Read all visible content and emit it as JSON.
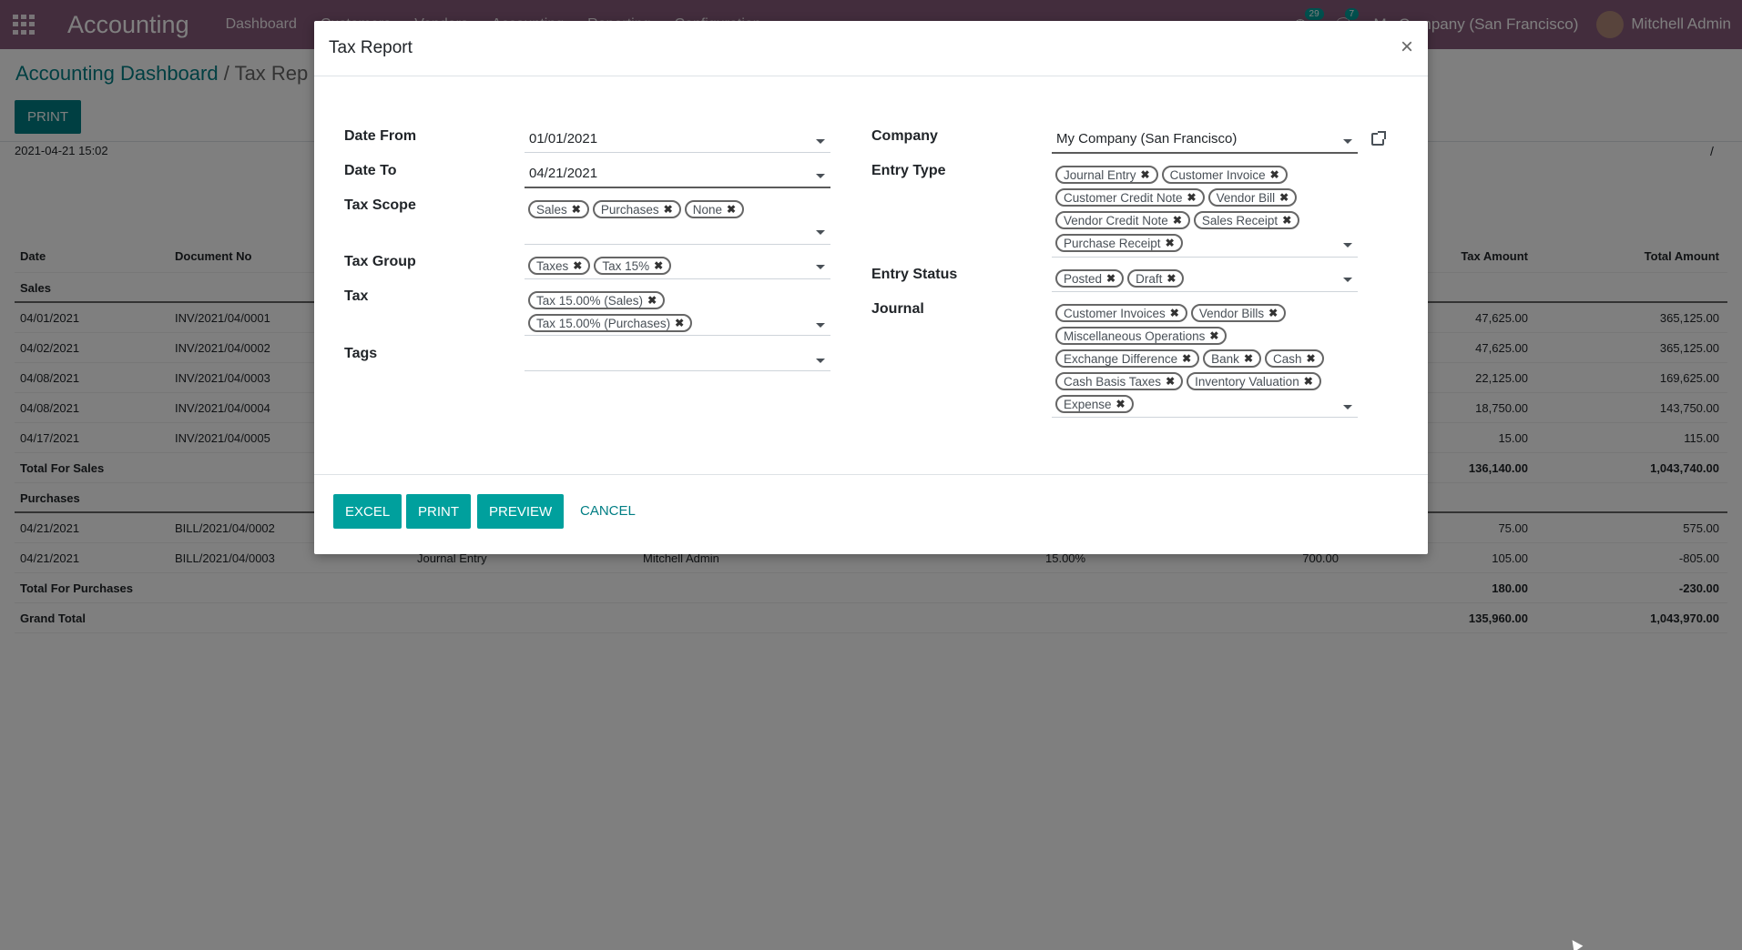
{
  "navbar": {
    "app_title": "Accounting",
    "menu": [
      "Dashboard",
      "Customers",
      "Vendors",
      "Accounting",
      "Reporting",
      "Configuration"
    ],
    "activity_count": "29",
    "messages_count": "7",
    "company": "My Company (San Francisco)",
    "user": "Mitchell Admin",
    "color": "#875A7B"
  },
  "breadcrumb": {
    "parent": "Accounting Dashboard",
    "separator": "/",
    "current": "Tax Rep"
  },
  "page": {
    "print_label": "PRINT",
    "generated_at": "2021-04-21 15:02",
    "slash": "/"
  },
  "report": {
    "headers": {
      "date": "Date",
      "document": "Document No",
      "tax_amount": "Tax Amount",
      "total_amount": "Total Amount"
    },
    "sales": {
      "title": "Sales",
      "rows": [
        {
          "date": "04/01/2021",
          "doc": "INV/2021/04/0001",
          "tax": "47,625.00",
          "total": "365,125.00"
        },
        {
          "date": "04/02/2021",
          "doc": "INV/2021/04/0002",
          "tax": "47,625.00",
          "total": "365,125.00"
        },
        {
          "date": "04/08/2021",
          "doc": "INV/2021/04/0003",
          "tax": "22,125.00",
          "total": "169,625.00"
        },
        {
          "date": "04/08/2021",
          "doc": "INV/2021/04/0004",
          "tax": "18,750.00",
          "total": "143,750.00"
        },
        {
          "date": "04/17/2021",
          "doc": "INV/2021/04/0005",
          "tax": "15.00",
          "total": "115.00"
        }
      ],
      "total_label": "Total For Sales",
      "total_tax": "136,140.00",
      "total_amount": "1,043,740.00"
    },
    "purchases": {
      "title": "Purchases",
      "rows": [
        {
          "date": "04/21/2021",
          "doc": "BILL/2021/04/0002",
          "type": "",
          "user": "",
          "rate": "",
          "base": "",
          "tax": "75.00",
          "total": "575.00"
        },
        {
          "date": "04/21/2021",
          "doc": "BILL/2021/04/0003",
          "type": "Journal Entry",
          "user": "Mitchell Admin",
          "rate": "15.00%",
          "base": "700.00",
          "tax": "105.00",
          "total": "-805.00"
        }
      ],
      "total_label": "Total For Purchases",
      "total_tax": "180.00",
      "total_amount": "-230.00"
    },
    "grand_total": {
      "label": "Grand Total",
      "tax": "135,960.00",
      "total": "1,043,970.00"
    }
  },
  "modal": {
    "title": "Tax Report",
    "close": "×",
    "fields": {
      "date_from": {
        "label": "Date From",
        "value": "01/01/2021"
      },
      "date_to": {
        "label": "Date To",
        "value": "04/21/2021"
      },
      "tax_scope": {
        "label": "Tax Scope",
        "tags": [
          "Sales",
          "Purchases",
          "None"
        ]
      },
      "tax_group": {
        "label": "Tax Group",
        "tags": [
          "Taxes",
          "Tax 15%"
        ]
      },
      "tax": {
        "label": "Tax",
        "tags": [
          "Tax 15.00% (Sales)",
          "Tax 15.00% (Purchases)"
        ]
      },
      "tags": {
        "label": "Tags",
        "tags": []
      },
      "company": {
        "label": "Company",
        "value": "My Company (San Francisco)"
      },
      "entry_type": {
        "label": "Entry Type",
        "tags": [
          "Journal Entry",
          "Customer Invoice",
          "Customer Credit Note",
          "Vendor Bill",
          "Vendor Credit Note",
          "Sales Receipt",
          "Purchase Receipt"
        ]
      },
      "entry_status": {
        "label": "Entry Status",
        "tags": [
          "Posted",
          "Draft"
        ]
      },
      "journal": {
        "label": "Journal",
        "tags": [
          "Customer Invoices",
          "Vendor Bills",
          "Miscellaneous Operations",
          "Exchange Difference",
          "Bank",
          "Cash",
          "Cash Basis Taxes",
          "Inventory Valuation",
          "Expense"
        ]
      }
    },
    "footer": {
      "excel": "EXCEL",
      "print": "PRINT",
      "preview": "PREVIEW",
      "cancel": "CANCEL"
    },
    "accent": "#00A09D"
  }
}
